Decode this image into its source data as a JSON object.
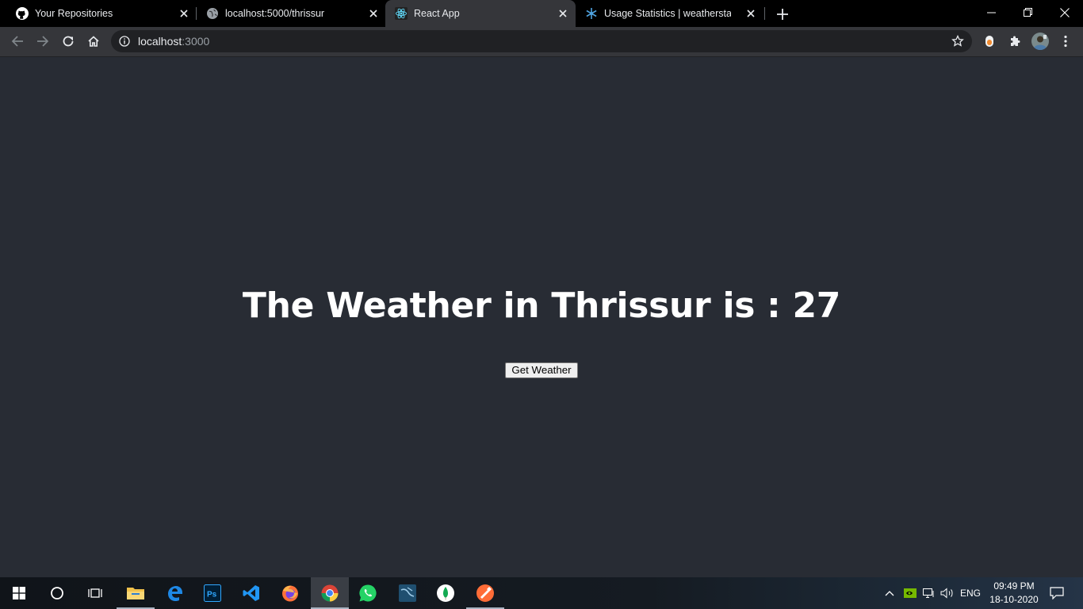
{
  "browser": {
    "tabs": [
      {
        "title": "Your Repositories",
        "icon": "github-icon",
        "active": false
      },
      {
        "title": "localhost:5000/thrissur",
        "icon": "globe-icon",
        "active": false
      },
      {
        "title": "React App",
        "icon": "react-icon",
        "active": true
      },
      {
        "title": "Usage Statistics | weatherstack API",
        "icon": "weatherstack-icon",
        "active": false
      }
    ],
    "url_host": "localhost",
    "url_port": ":3000"
  },
  "page": {
    "heading": "The Weather in Thrissur is : 27",
    "button_label": "Get Weather"
  },
  "taskbar": {
    "apps": [
      "windows-start-icon",
      "cortana-search-icon",
      "task-view-icon",
      "file-explorer-icon",
      "edge-icon",
      "photoshop-icon",
      "vscode-icon",
      "firefox-icon",
      "chrome-icon",
      "whatsapp-icon",
      "mysql-workbench-icon",
      "mongodb-compass-icon",
      "postman-icon"
    ],
    "language": "ENG",
    "time": "09:49 PM",
    "date": "18-10-2020"
  },
  "colors": {
    "page_background": "#282c34",
    "heading_text": "#ffffff",
    "tab_strip": "#000000",
    "toolbar": "#35363a"
  }
}
